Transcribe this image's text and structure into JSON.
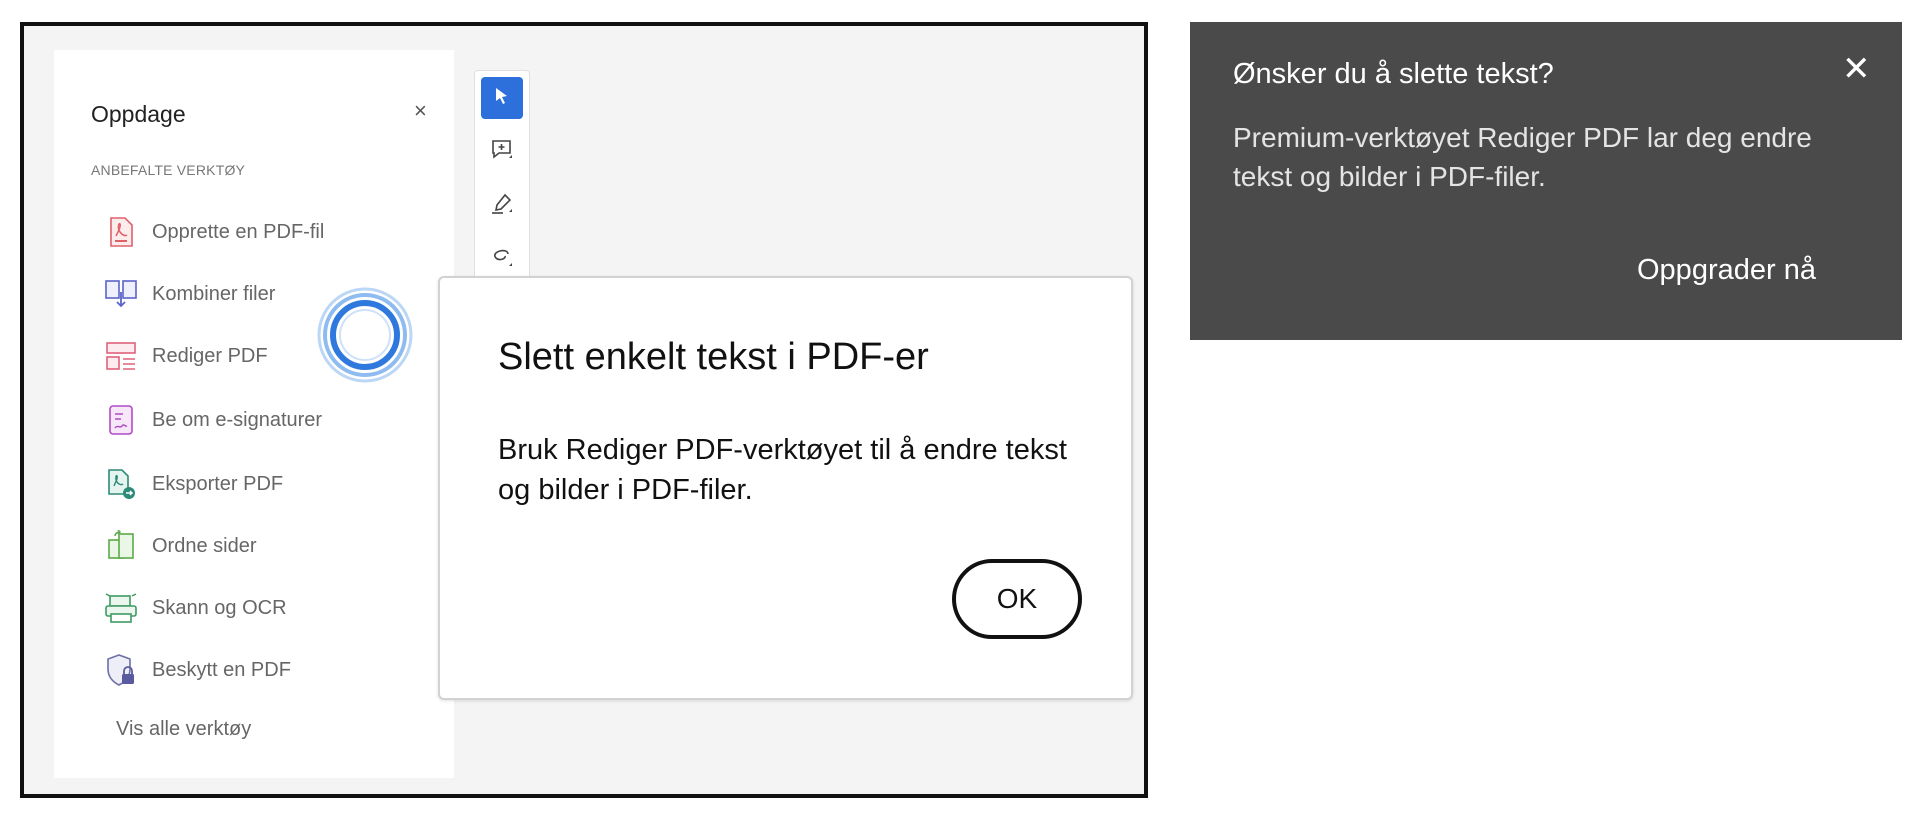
{
  "sidebar": {
    "title": "Oppdage",
    "close_label": "×",
    "section_label": "ANBEFALTE VERKTØY",
    "tools": [
      {
        "label": "Opprette en PDF-fil",
        "icon": "create-pdf-icon"
      },
      {
        "label": "Kombiner filer",
        "icon": "combine-files-icon"
      },
      {
        "label": "Rediger PDF",
        "icon": "edit-pdf-icon"
      },
      {
        "label": "Be om e-signaturer",
        "icon": "request-signatures-icon"
      },
      {
        "label": "Eksporter PDF",
        "icon": "export-pdf-icon"
      },
      {
        "label": "Ordne sider",
        "icon": "organize-pages-icon"
      },
      {
        "label": "Skann og OCR",
        "icon": "scan-ocr-icon"
      },
      {
        "label": "Beskytt en PDF",
        "icon": "protect-pdf-icon"
      }
    ],
    "show_all_label": "Vis alle verktøy"
  },
  "toolbar": {
    "tools": [
      "select-cursor-icon",
      "add-comment-icon",
      "highlight-pen-icon",
      "draw-lasso-icon"
    ],
    "active_color": "#2d6fdb"
  },
  "dialog": {
    "title": "Slett enkelt tekst i PDF-er",
    "body": "Bruk Rediger PDF-verktøyet til å endre tekst og bilder i PDF-filer.",
    "ok_label": "OK"
  },
  "tooltip": {
    "title": "Ønsker du å slette tekst?",
    "close_label": "✕",
    "body": "Premium-verktøyet Rediger PDF lar deg endre tekst og bilder i PDF-filer.",
    "cta_label": "Oppgrader nå",
    "background": "#4a4a4a"
  }
}
